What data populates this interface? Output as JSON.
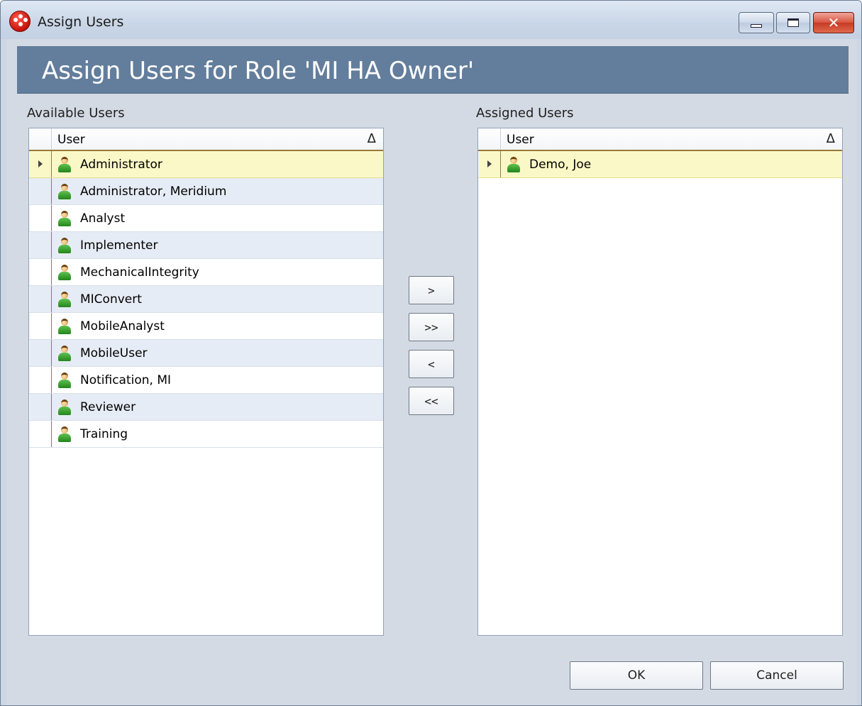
{
  "window": {
    "title": "Assign Users",
    "icon": "red-app-icon",
    "controls": [
      "minimize-icon",
      "restore-icon",
      "close-icon"
    ],
    "close_glyph": "✕"
  },
  "header": {
    "title": "Assign Users for Role 'MI HA Owner'"
  },
  "available": {
    "label": "Available Users",
    "column_header": "User",
    "sort_indicator": "Δ",
    "rows": [
      "Administrator",
      "Administrator, Meridium",
      "Analyst",
      "Implementer",
      "MechanicalIntegrity",
      "MIConvert",
      "MobileAnalyst",
      "MobileUser",
      "Notification, MI",
      "Reviewer",
      "Training"
    ],
    "selected_row": "Administrator"
  },
  "assigned": {
    "label": "Assigned Users",
    "column_header": "User",
    "sort_indicator": "Δ",
    "rows": [
      "Demo, Joe"
    ],
    "selected_row": "Demo, Joe"
  },
  "move_buttons": {
    "add": ">",
    "add_all": ">>",
    "remove": "<",
    "remove_all": "<<"
  },
  "dialog_buttons": {
    "ok": "OK",
    "cancel": "Cancel"
  },
  "colors": {
    "header_band": "#637e9c",
    "client_bg": "#d4dae3",
    "selected_row": "#fbf8c7",
    "alt_row": "#e6ecf5"
  }
}
